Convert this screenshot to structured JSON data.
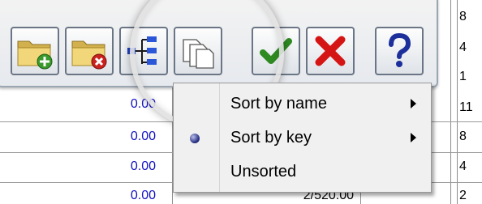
{
  "sheet": {
    "left_values": [
      "0.00",
      "0.00",
      "0.00",
      "0.00"
    ],
    "right_partial_values": [
      "8",
      "4",
      "1",
      "11",
      "8",
      "4",
      "2"
    ],
    "bottom_mid_value": "2/520.00"
  },
  "toolbar": {
    "buttons": [
      {
        "name": "folder-add-icon"
      },
      {
        "name": "folder-remove-icon"
      },
      {
        "name": "tree-hierarchy-icon"
      },
      {
        "name": "copy-pages-icon"
      },
      {
        "name": "checkmark-icon"
      },
      {
        "name": "cross-icon"
      },
      {
        "name": "help-icon"
      }
    ]
  },
  "menu": {
    "items": [
      {
        "label": "Sort by name",
        "has_submenu": true,
        "checked": false
      },
      {
        "label": "Sort by key",
        "has_submenu": true,
        "checked": true
      },
      {
        "label": "Unsorted",
        "has_submenu": false,
        "checked": false
      }
    ]
  },
  "colors": {
    "cell_text": "#1212c4",
    "confirm": "#2f8a21",
    "cancel": "#d51414",
    "help": "#1c2f9a"
  }
}
